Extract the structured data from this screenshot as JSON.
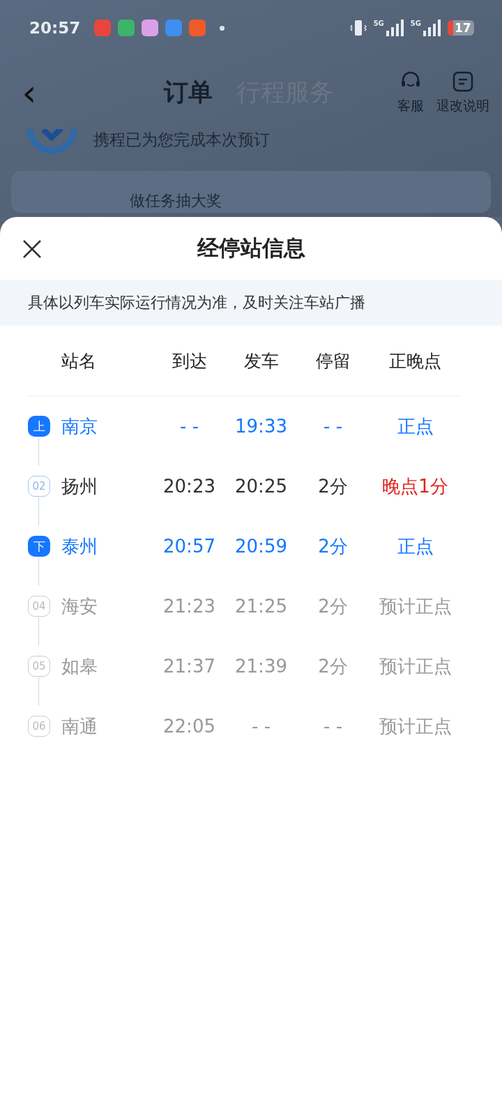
{
  "status_bar": {
    "time": "20:57",
    "signal_labels": [
      "5G",
      "5G"
    ],
    "battery": "17"
  },
  "header": {
    "back": "‹",
    "tabs": [
      {
        "label": "订单",
        "selected": true
      },
      {
        "label": "行程服务",
        "selected": false
      }
    ],
    "actions": [
      {
        "kind": "service",
        "label": "客服"
      },
      {
        "kind": "rules",
        "label": "退改说明"
      }
    ]
  },
  "background": {
    "subtitle": "携程已为您完成本次预订",
    "promo": "做任务抽大奖"
  },
  "sheet": {
    "title": "经停站信息",
    "notice": "具体以列车实际运行情况为准，及时关注车站广播",
    "columns": [
      "站名",
      "到达",
      "发车",
      "停留",
      "正晚点"
    ],
    "rows": [
      {
        "marker": "上",
        "kind": "endpoint",
        "name": "南京",
        "arrive": "- -",
        "depart": "19:33",
        "stop": "- -",
        "status": "正点",
        "late": false
      },
      {
        "marker": "02",
        "kind": "passed",
        "name": "扬州",
        "arrive": "20:23",
        "depart": "20:25",
        "stop": "2分",
        "status": "晚点1分",
        "late": true
      },
      {
        "marker": "下",
        "kind": "endpoint",
        "name": "泰州",
        "arrive": "20:57",
        "depart": "20:59",
        "stop": "2分",
        "status": "正点",
        "late": false
      },
      {
        "marker": "04",
        "kind": "upcoming",
        "name": "海安",
        "arrive": "21:23",
        "depart": "21:25",
        "stop": "2分",
        "status": "预计正点",
        "late": false
      },
      {
        "marker": "05",
        "kind": "upcoming",
        "name": "如皋",
        "arrive": "21:37",
        "depart": "21:39",
        "stop": "2分",
        "status": "预计正点",
        "late": false
      },
      {
        "marker": "06",
        "kind": "upcoming",
        "name": "南通",
        "arrive": "22:05",
        "depart": "- -",
        "stop": "- -",
        "status": "预计正点",
        "late": false
      }
    ]
  }
}
